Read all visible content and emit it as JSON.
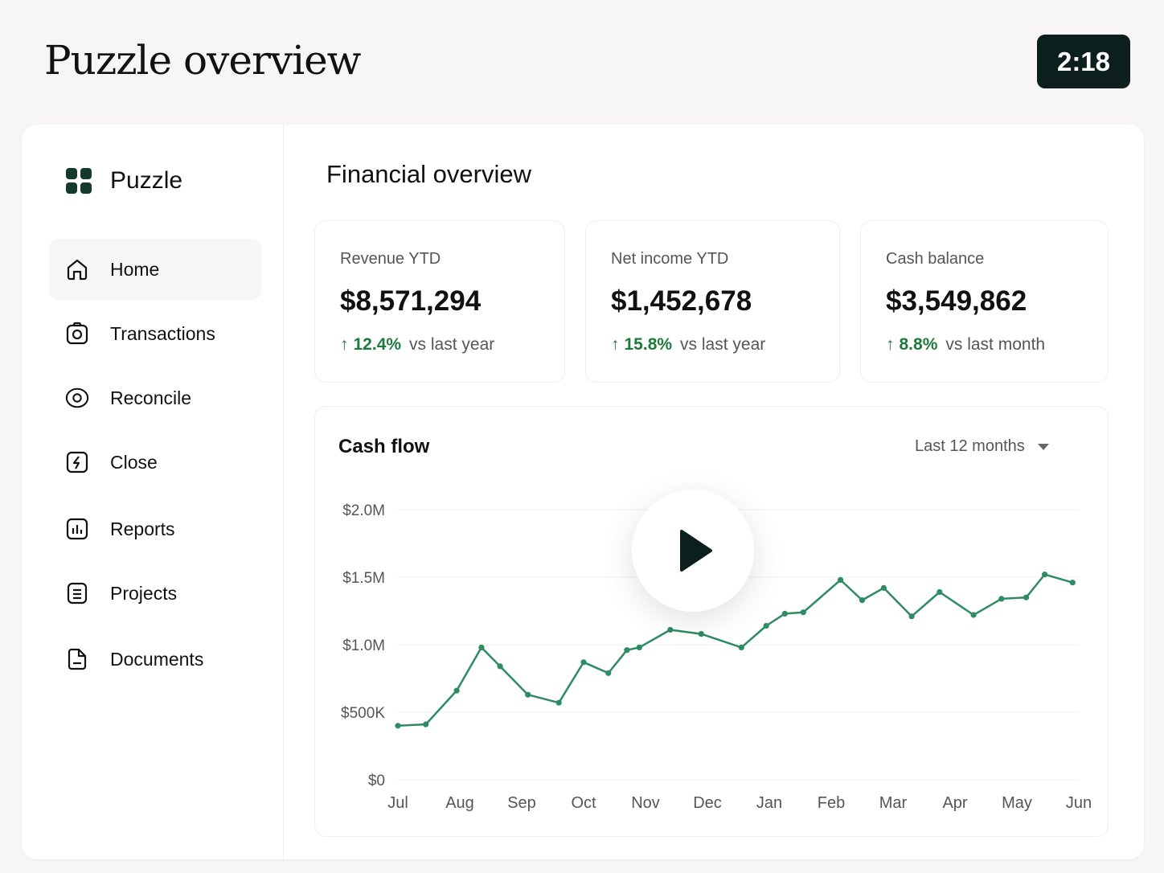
{
  "header": {
    "title": "Puzzle overview",
    "timer": "2:18"
  },
  "sidebar": {
    "brand": "Puzzle",
    "items": [
      {
        "label": "Home",
        "icon": "home-icon",
        "active": true
      },
      {
        "label": "Transactions",
        "icon": "camera-icon"
      },
      {
        "label": "Reconcile",
        "icon": "eye-icon"
      },
      {
        "label": "Close",
        "icon": "lightning-icon"
      },
      {
        "label": "Reports",
        "icon": "report-icon"
      },
      {
        "label": "Projects",
        "icon": "list-icon"
      },
      {
        "label": "Documents",
        "icon": "document-icon"
      }
    ]
  },
  "main": {
    "title": "Financial overview",
    "kpis": [
      {
        "label": "Revenue YTD",
        "value": "$8,571,294",
        "delta": "12.4%",
        "comparison": "vs last year"
      },
      {
        "label": "Net income YTD",
        "value": "$1,452,678",
        "delta": "15.8%",
        "comparison": "vs last year"
      },
      {
        "label": "Cash balance",
        "value": "$3,549,862",
        "delta": "8.8%",
        "comparison": "vs last month"
      }
    ],
    "cashflow": {
      "title": "Cash flow",
      "range": "Last 12 months"
    }
  },
  "colors": {
    "accent": "#2e8b62",
    "positive": "#1d7a3d",
    "timer_bg": "#0d1f1c",
    "brand": "#14392f"
  },
  "chart_data": {
    "type": "line",
    "title": "Cash flow",
    "categories": [
      "Jul",
      "Aug",
      "Sep",
      "Oct",
      "Nov",
      "Dec",
      "Jan",
      "Feb",
      "Mar",
      "Apr",
      "May",
      "Jun"
    ],
    "y_ticks": [
      "$0",
      "$500K",
      "$1.0M",
      "$1.5M",
      "$2.0M"
    ],
    "ylim": [
      0,
      2000000
    ],
    "grid": true,
    "series": [
      {
        "x": [
          0,
          0.45,
          0.95,
          1.35,
          1.65,
          2.1,
          2.6,
          3.0,
          3.4,
          3.7,
          3.9,
          4.4,
          4.9,
          5.55,
          5.95,
          6.25,
          6.55,
          7.15,
          7.5,
          7.85,
          8.3,
          8.75,
          9.3,
          9.75,
          10.15,
          10.45,
          10.9
        ],
        "y": [
          400000,
          410000,
          660000,
          980000,
          840000,
          630000,
          570000,
          870000,
          790000,
          960000,
          980000,
          1110000,
          1080000,
          980000,
          1140000,
          1230000,
          1240000,
          1480000,
          1330000,
          1420000,
          1210000,
          1390000,
          1220000,
          1340000,
          1350000,
          1520000,
          1460000
        ]
      }
    ]
  }
}
